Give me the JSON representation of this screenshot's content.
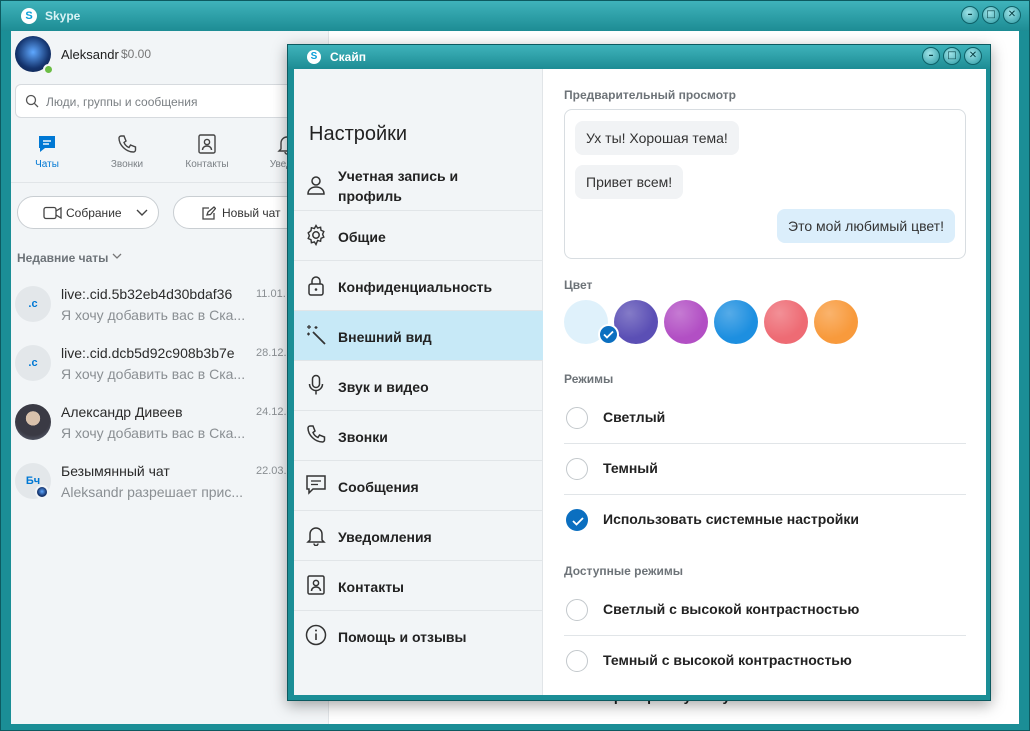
{
  "main_window": {
    "title": "Skype",
    "title_logo": "S",
    "controls": [
      "–",
      "□",
      "✕"
    ],
    "profile": {
      "name": "Aleksandr",
      "credit": "$0.00"
    },
    "search": {
      "placeholder": "Люди, группы и сообщения"
    },
    "nav_tabs": [
      {
        "label": "Чаты",
        "icon": "chat-icon"
      },
      {
        "label": "Звонки",
        "icon": "phone-icon"
      },
      {
        "label": "Контакты",
        "icon": "contacts-icon"
      },
      {
        "label": "Уведом",
        "icon": "bell-icon"
      }
    ],
    "buttons": {
      "meeting": "Собрание",
      "new_chat": "Новый чат"
    },
    "recent_header": "Недавние чаты",
    "chats": [
      {
        "avatar_text": ".c",
        "title": "live:.cid.5b32eb4d30bdaf36",
        "date": "11.01.",
        "preview": "Я хочу добавить вас в Ска..."
      },
      {
        "avatar_text": ".c",
        "title": "live:.cid.dcb5d92c908b3b7e",
        "date": "28.12.",
        "preview": "Я хочу добавить вас в Ска..."
      },
      {
        "avatar_text": "",
        "title": "Александр Дивеев",
        "date": "24.12.",
        "preview": "Я хочу добавить вас в Ска..."
      },
      {
        "avatar_text": "Бч",
        "title": "Безымянный чат",
        "date": "22.03.",
        "preview": "Aleksandr разрешает прис..."
      }
    ],
    "background_fragment": "Не вы? Проверить учетную запись"
  },
  "settings_dialog": {
    "title": "Скайп",
    "title_logo": "S",
    "controls": [
      "–",
      "□",
      "✕"
    ],
    "heading": "Настройки",
    "nav_items": [
      {
        "label": "Учетная запись и профиль",
        "line1": "Учетная запись и",
        "line2": "профиль",
        "icon": "person-icon"
      },
      {
        "label": "Общие",
        "icon": "gear-icon"
      },
      {
        "label": "Конфиденциальность",
        "icon": "lock-icon"
      },
      {
        "label": "Внешний вид",
        "icon": "magic-wand-icon",
        "active": true
      },
      {
        "label": "Звук и видео",
        "icon": "microphone-icon"
      },
      {
        "label": "Звонки",
        "icon": "phone-icon"
      },
      {
        "label": "Сообщения",
        "icon": "message-icon"
      },
      {
        "label": "Уведомления",
        "icon": "bell-icon"
      },
      {
        "label": "Контакты",
        "icon": "contacts-icon"
      },
      {
        "label": "Помощь и отзывы",
        "icon": "info-icon"
      }
    ],
    "preview": {
      "label": "Предварительный просмотр",
      "incoming": [
        "Ух ты! Хорошая тема!",
        "Привет всем!"
      ],
      "outgoing": [
        "Это мой любимый цвет!"
      ]
    },
    "color": {
      "label": "Цвет",
      "swatches": [
        "#dff1fb",
        "#5b4fb5",
        "#b24fc4",
        "#1d8fe0",
        "#ee6b74",
        "#f89a3c"
      ],
      "selected_index": 0
    },
    "modes": {
      "label": "Режимы",
      "options": [
        "Светлый",
        "Темный",
        "Использовать системные настройки"
      ],
      "selected_index": 2
    },
    "available_modes": {
      "label": "Доступные режимы",
      "options": [
        "Светлый с высокой контрастностью",
        "Темный с высокой контрастностью"
      ]
    }
  }
}
